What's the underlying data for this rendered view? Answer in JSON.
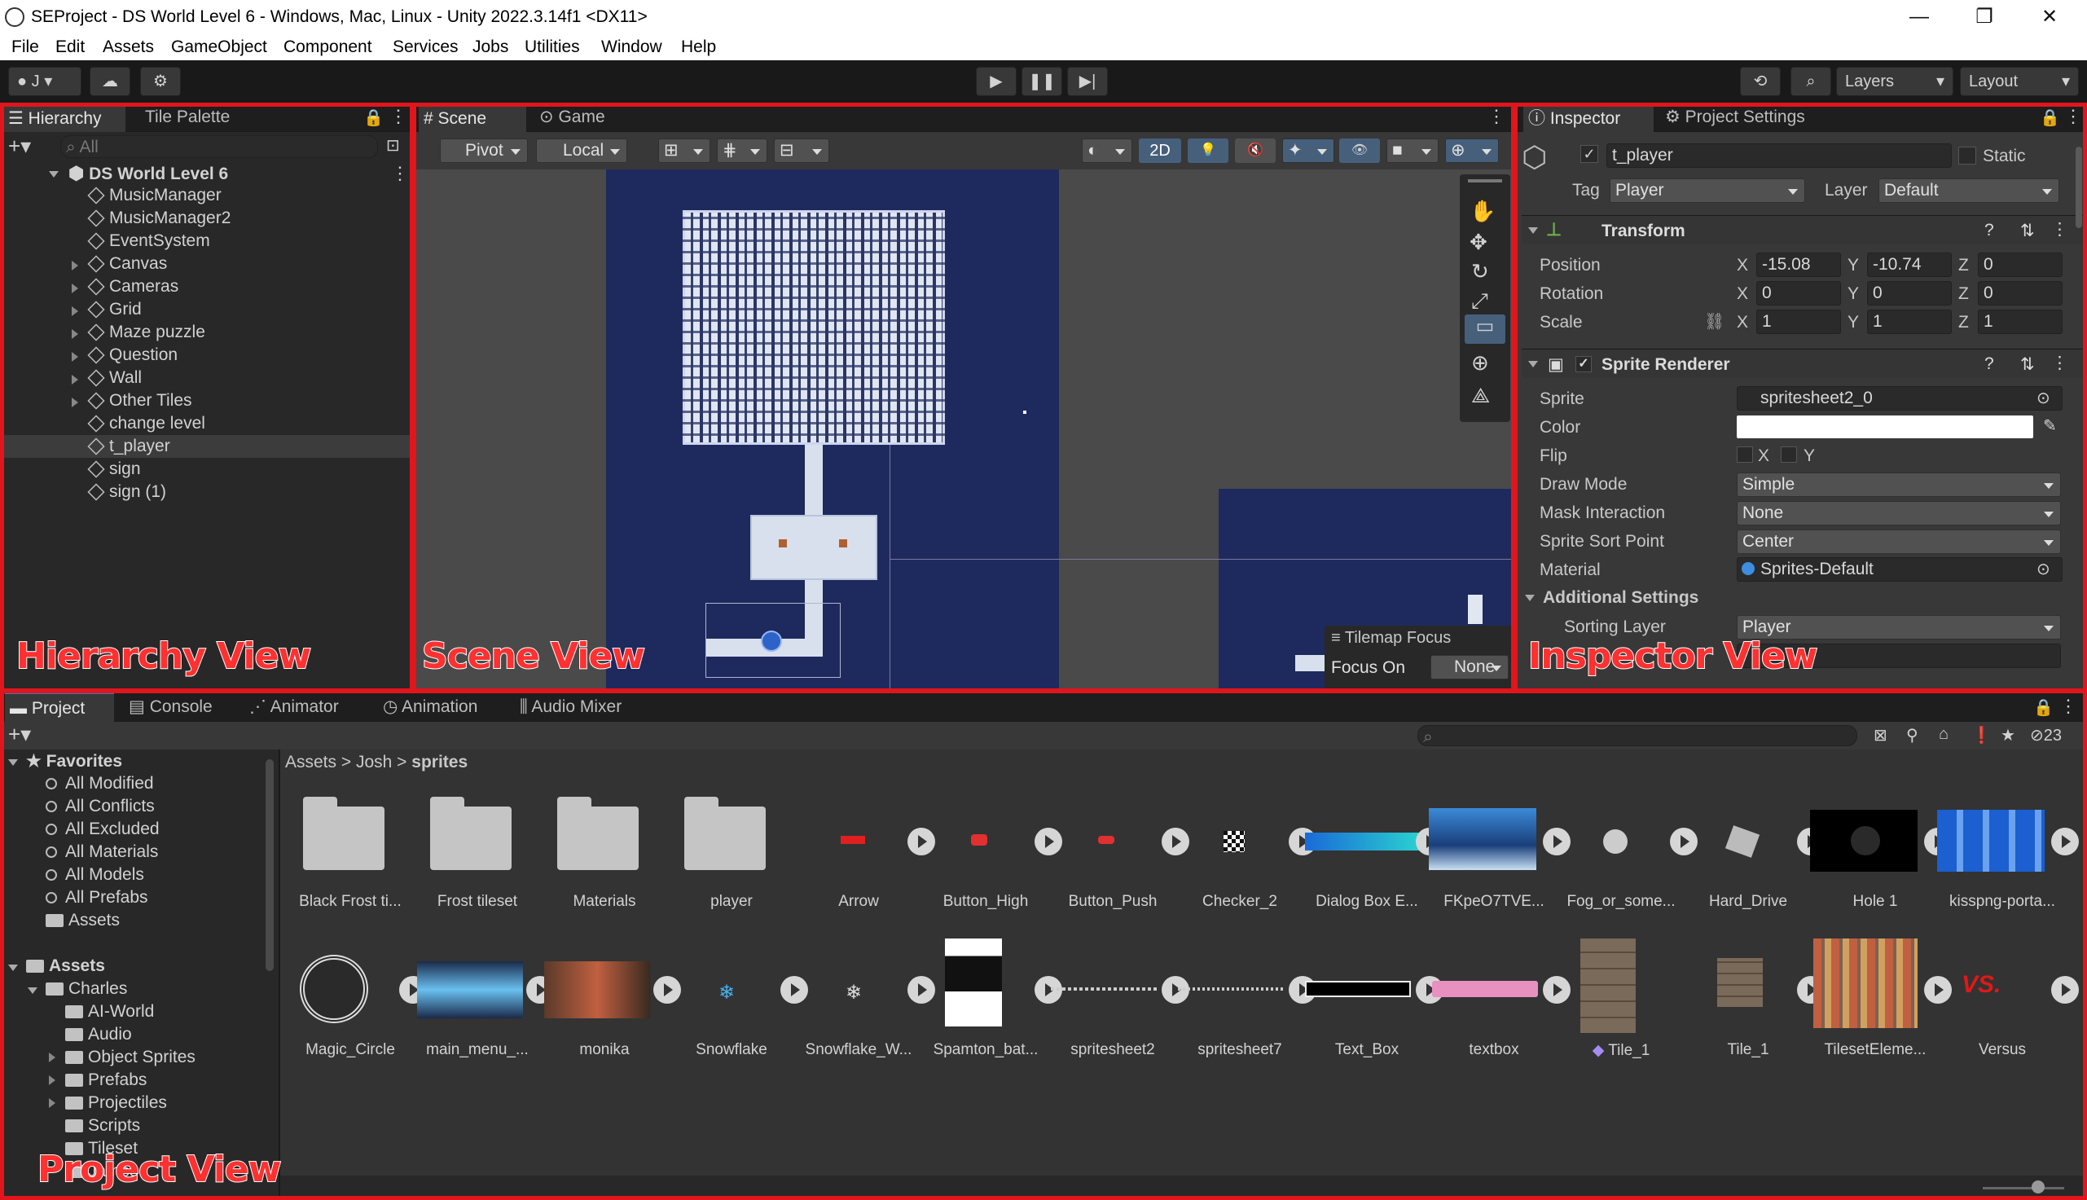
{
  "window": {
    "title": "SEProject - DS World Level 6 - Windows, Mac, Linux - Unity 2022.3.14f1 <DX11>",
    "minimize": "—",
    "maximize": "❐",
    "close": "✕"
  },
  "menu": [
    "File",
    "Edit",
    "Assets",
    "GameObject",
    "Component",
    "Services",
    "Jobs",
    "Utilities",
    "Window",
    "Help"
  ],
  "toolbar": {
    "account": "J",
    "layers": "Layers",
    "layout": "Layout"
  },
  "hierarchy": {
    "tabs": [
      "Hierarchy",
      "Tile Palette"
    ],
    "search_placeholder": "All",
    "scene": "DS World Level 6",
    "items": [
      "MusicManager",
      "MusicManager2",
      "EventSystem",
      "Canvas",
      "Cameras",
      "Grid",
      "Maze puzzle",
      "Question",
      "Wall",
      "Other Tiles",
      "change level",
      "t_player",
      "sign",
      "sign (1)"
    ]
  },
  "scene_view": {
    "tabs": [
      "Scene",
      "Game"
    ],
    "pivot": "Pivot",
    "local": "Local",
    "mode_2d": "2D",
    "overlay_title": "Tilemap Focus",
    "focus_on": "Focus On",
    "focus_value": "None"
  },
  "inspector": {
    "tabs": [
      "Inspector",
      "Project Settings"
    ],
    "object_name": "t_player",
    "static_label": "Static",
    "tag_label": "Tag",
    "tag": "Player",
    "layer_label": "Layer",
    "layer": "Default",
    "transform": {
      "title": "Transform",
      "position_label": "Position",
      "rotation_label": "Rotation",
      "scale_label": "Scale",
      "x": "X",
      "y": "Y",
      "z": "Z",
      "position": [
        "-15.08",
        "-10.74",
        "0"
      ],
      "rotation": [
        "0",
        "0",
        "0"
      ],
      "scale": [
        "1",
        "1",
        "1"
      ]
    },
    "sprite_renderer": {
      "title": "Sprite Renderer",
      "sprite_label": "Sprite",
      "sprite": "spritesheet2_0",
      "color_label": "Color",
      "flip_label": "Flip",
      "flip_x": "X",
      "flip_y": "Y",
      "draw_mode_label": "Draw Mode",
      "draw_mode": "Simple",
      "mask_label": "Mask Interaction",
      "mask": "None",
      "sort_point_label": "Sprite Sort Point",
      "sort_point": "Center",
      "material_label": "Material",
      "material": "Sprites-Default",
      "additional": "Additional Settings",
      "sorting_layer_label": "Sorting Layer",
      "sorting_layer": "Player"
    }
  },
  "project": {
    "tabs": [
      "Project",
      "Console",
      "Animator",
      "Animation",
      "Audio Mixer"
    ],
    "hidden_count": "23",
    "favorites_title": "Favorites",
    "favorites": [
      "All Modified",
      "All Conflicts",
      "All Excluded",
      "All Materials",
      "All Models",
      "All Prefabs",
      "Assets"
    ],
    "assets_title": "Assets",
    "charles": "Charles",
    "charles_children": [
      "AI-World",
      "Audio",
      "Object Sprites",
      "Prefabs",
      "Projectiles",
      "Scripts",
      "Tileset"
    ],
    "cut_item": "James",
    "breadcrumb": [
      "Assets",
      "Josh",
      "sprites"
    ],
    "row1": [
      "Black Frost ti...",
      "Frost tileset",
      "Materials",
      "player",
      "Arrow",
      "Button_High",
      "Button_Push",
      "Checker_2",
      "Dialog Box E...",
      "FKpeO7TVE...",
      "Fog_or_some...",
      "Hard_Drive",
      "Hole 1",
      "kisspng-porta..."
    ],
    "row2": [
      "Magic_Circle",
      "main_menu_...",
      "monika",
      "Snowflake",
      "Snowflake_W...",
      "Spamton_bat...",
      "spritesheet2",
      "spritesheet7",
      "Text_Box",
      "textbox",
      "Tile_1",
      "Tile_1",
      "TilesetEleme...",
      "Versus"
    ]
  },
  "annotations": {
    "hierarchy": "Hierarchy View",
    "scene": "Scene View",
    "inspector": "Inspector View",
    "project": "Project View"
  },
  "colors": {
    "accent": "#3a79bb",
    "annotation": "#e1151b",
    "scene_bg": "#1e2a5e",
    "scene_outer": "#4a4a4a"
  }
}
